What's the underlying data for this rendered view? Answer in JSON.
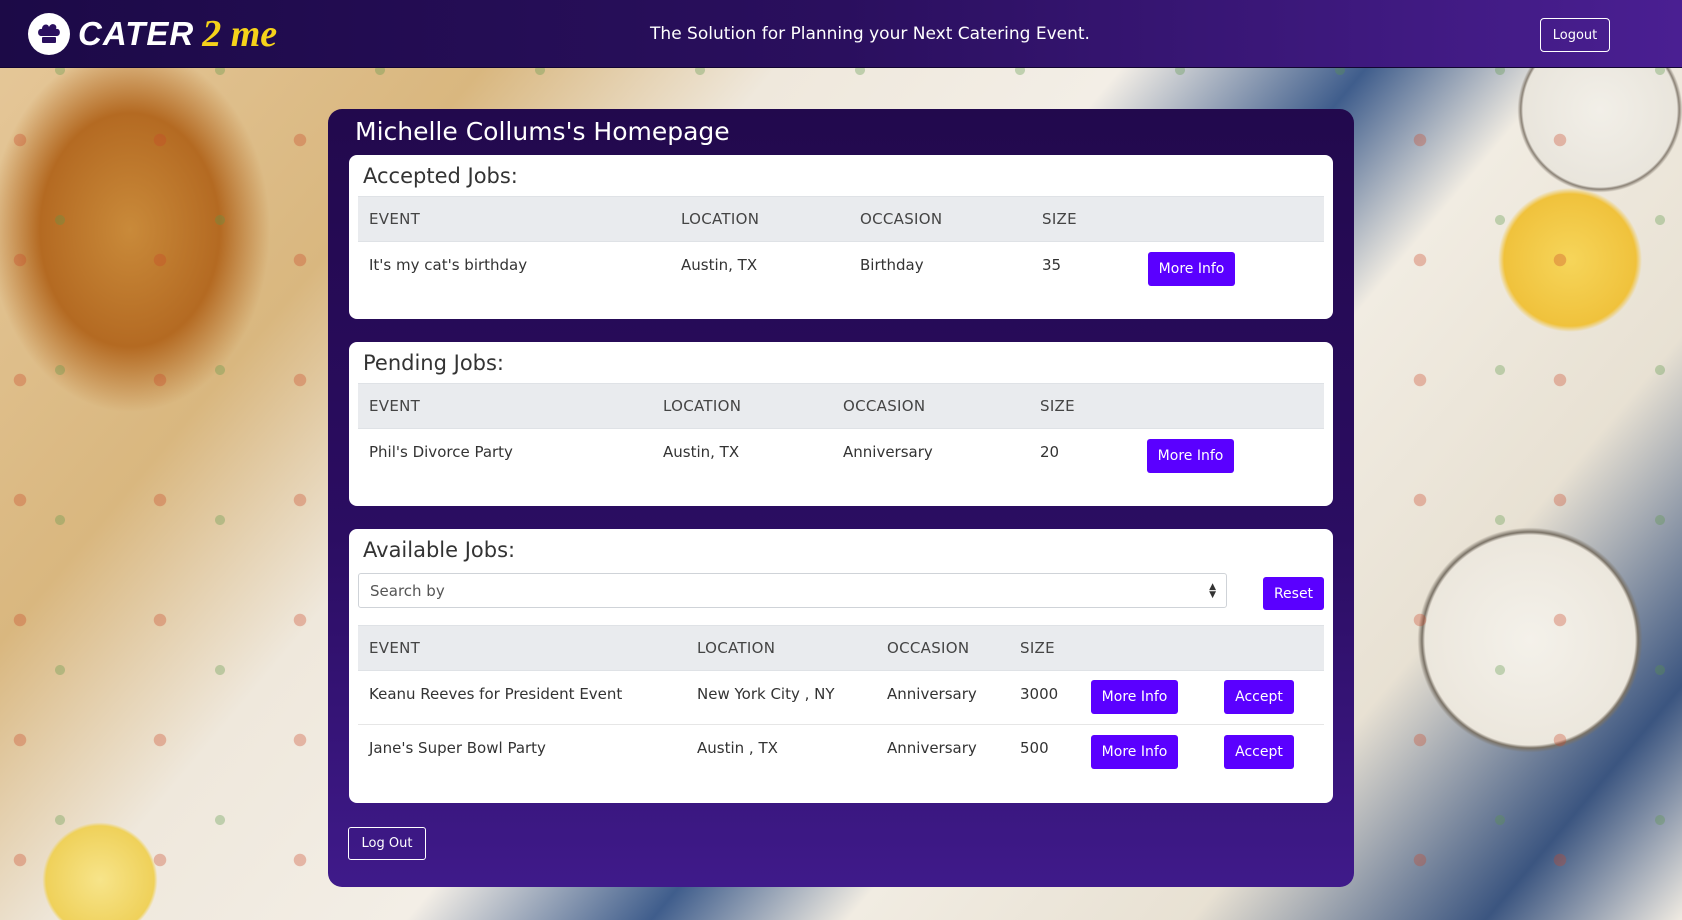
{
  "header": {
    "brand_part1": "CATER",
    "brand_part2": "2 me",
    "tagline": "The Solution for Planning your Next Catering Event.",
    "logout_label": "Logout",
    "logo_icon": "chef-hat-icon"
  },
  "page": {
    "title": "Michelle Collums's Homepage",
    "logout_label": "Log Out"
  },
  "columns": [
    "EVENT",
    "LOCATION",
    "OCCASION",
    "SIZE"
  ],
  "accepted": {
    "heading": "Accepted Jobs:",
    "rows": [
      {
        "event": "It's my cat's birthday",
        "location": "Austin, TX",
        "occasion": "Birthday",
        "size": "35",
        "more_label": "More Info"
      }
    ]
  },
  "pending": {
    "heading": "Pending Jobs:",
    "rows": [
      {
        "event": "Phil's Divorce Party",
        "location": "Austin, TX",
        "occasion": "Anniversary",
        "size": "20",
        "more_label": "More Info"
      }
    ]
  },
  "available": {
    "heading": "Available Jobs:",
    "search_placeholder": "Search by",
    "reset_label": "Reset",
    "rows": [
      {
        "event": "Keanu Reeves for President Event",
        "location": "New York City , NY",
        "occasion": "Anniversary",
        "size": "3000",
        "more_label": "More Info",
        "accept_label": "Accept"
      },
      {
        "event": "Jane's Super Bowl Party",
        "location": "Austin , TX",
        "occasion": "Anniversary",
        "size": "500",
        "more_label": "More Info",
        "accept_label": "Accept"
      }
    ]
  },
  "colors": {
    "header_start": "#1c0a47",
    "header_end": "#4a1f92",
    "card": "#2b0d62",
    "button": "#5a00ff",
    "brand_yellow": "#f5d21a"
  }
}
